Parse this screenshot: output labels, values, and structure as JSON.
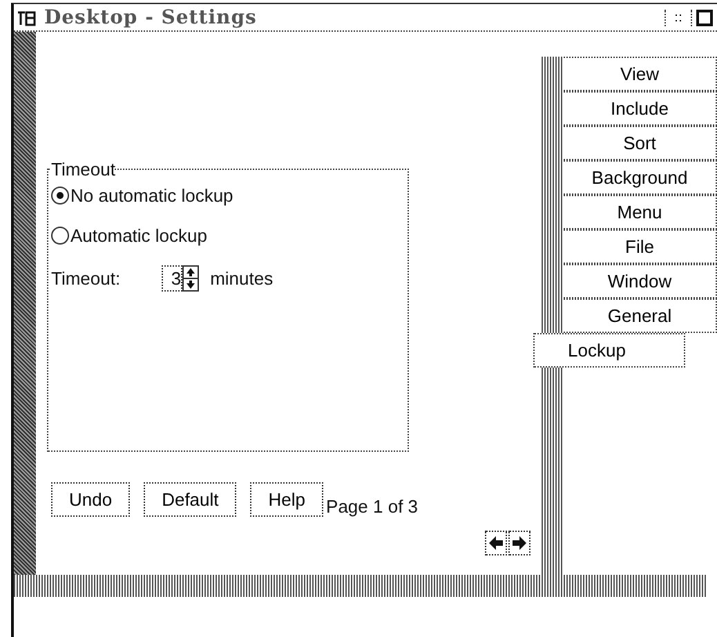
{
  "window": {
    "title": "Desktop - Settings"
  },
  "group": {
    "title": "Timeout"
  },
  "options": [
    {
      "label": "No automatic lockup",
      "selected": true
    },
    {
      "label": "Automatic lockup",
      "selected": false
    }
  ],
  "timeout": {
    "label": "Timeout:",
    "value": "3",
    "unit": "minutes"
  },
  "buttons": [
    "Undo",
    "Default",
    "Help"
  ],
  "page_info": "Page 1 of 3",
  "tabs": [
    {
      "label": "View",
      "selected": false
    },
    {
      "label": "Include",
      "selected": false
    },
    {
      "label": "Sort",
      "selected": false
    },
    {
      "label": "Background",
      "selected": false
    },
    {
      "label": "Menu",
      "selected": false
    },
    {
      "label": "File",
      "selected": false
    },
    {
      "label": "Window",
      "selected": false
    },
    {
      "label": "General",
      "selected": false
    },
    {
      "label": "Lockup",
      "selected": true
    }
  ]
}
